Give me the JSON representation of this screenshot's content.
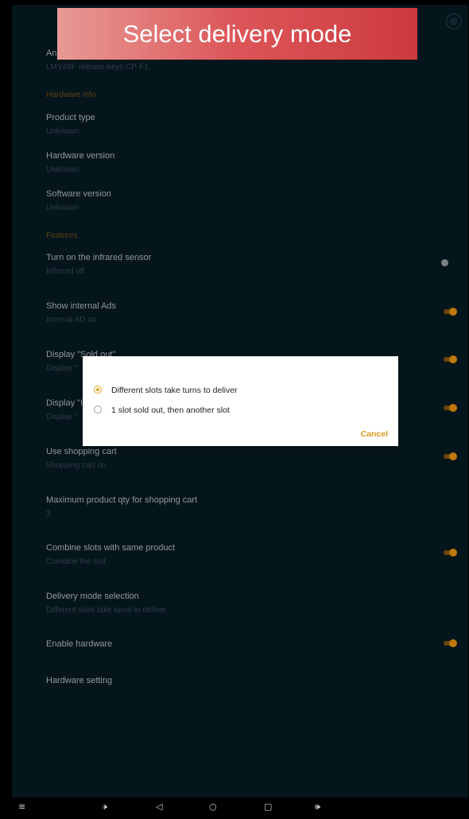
{
  "banner": {
    "title": "Select delivery mode"
  },
  "close_icon": "⊗",
  "build": {
    "title": "An",
    "summary": "LMY49F release-keys CP-F1"
  },
  "hardware_info": {
    "header": "Hardware info",
    "items": [
      {
        "title": "Product type",
        "summary": "Unknown"
      },
      {
        "title": "Hardware version",
        "summary": "Unknown"
      },
      {
        "title": "Software version",
        "summary": "Unknown"
      }
    ]
  },
  "features": {
    "header": "Features",
    "items": [
      {
        "title": "Turn on the infrared sensor",
        "summary": "Infrared off",
        "switch": "off"
      },
      {
        "title": "Show internal Ads",
        "summary": "Internal AD on",
        "switch": "on"
      },
      {
        "title": "Display \"Sold out\"",
        "summary": "Display \"",
        "switch": "on"
      },
      {
        "title": "Display \"I",
        "summary": "Display \"",
        "switch": "on"
      },
      {
        "title": "Use shopping cart",
        "summary": "Shopping cart on",
        "switch": "on"
      },
      {
        "title": "Maximum product qty for shopping cart",
        "summary": "3"
      },
      {
        "title": "Combine slots with same product",
        "summary": "Combine the slot",
        "switch": "on"
      },
      {
        "title": "Delivery mode selection",
        "summary": "Different slots take turns to deliver"
      },
      {
        "title": "Enable hardware",
        "switch": "on"
      },
      {
        "title": "Hardware setting"
      }
    ]
  },
  "dialog": {
    "options": [
      {
        "label": "Different slots take turns to deliver",
        "selected": true
      },
      {
        "label": "1 slot sold out, then another slot",
        "selected": false
      }
    ],
    "cancel_label": "Cancel"
  },
  "navbar": {
    "menu_icon": "≋",
    "volume_down_icon": "🕩",
    "back_icon": "◁",
    "home_icon": "○",
    "recents_icon": "▢",
    "volume_up_icon": "🕪"
  },
  "colors": {
    "accent": "#e4a72a",
    "background": "#061820",
    "banner": "#d9474b"
  }
}
